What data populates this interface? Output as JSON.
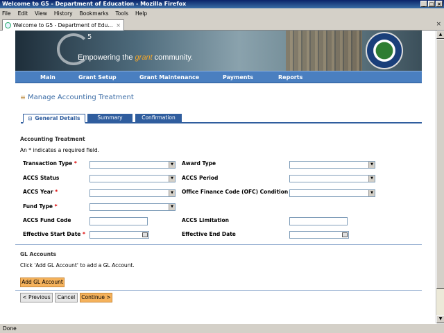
{
  "window": {
    "title": "Welcome to G5 - Department of Education - Mozilla Firefox"
  },
  "menu": [
    "File",
    "Edit",
    "View",
    "History",
    "Bookmarks",
    "Tools",
    "Help"
  ],
  "browser_tab": {
    "title": "Welcome to G5 - Department of Edu..."
  },
  "status": {
    "text": "Done"
  },
  "banner": {
    "tagline_prefix": "Empowering the ",
    "tagline_em": "grant",
    "tagline_suffix": " community.",
    "superscript": "5"
  },
  "nav": [
    "Main",
    "Grant Setup",
    "Grant Maintenance",
    "Payments",
    "Reports"
  ],
  "page_title": "Manage Accounting Treatment",
  "tabs": {
    "general": "General Details",
    "summary": "Summary",
    "confirmation": "Confirmation"
  },
  "section": {
    "title": "Accounting Treatment",
    "required_note": "An * indicates a required field."
  },
  "fields": {
    "transaction_type": "Transaction Type",
    "award_type": "Award Type",
    "accs_status": "ACCS Status",
    "accs_period": "ACCS Period",
    "accs_year": "ACCS Year",
    "ofc_condition": "Office Finance Code (OFC) Condition",
    "fund_type": "Fund Type",
    "accs_fund_code": "ACCS Fund Code",
    "accs_limitation": "ACCS Limitation",
    "effective_start_date": "Effective Start Date",
    "effective_end_date": "Effective End Date",
    "asterisk": "*"
  },
  "gl": {
    "title": "GL Accounts",
    "note": "Click 'Add GL Account' to add a GL Account.",
    "add_button": "Add GL Account"
  },
  "buttons": {
    "previous": "< Previous",
    "cancel": "Cancel",
    "continue": "Continue >"
  }
}
